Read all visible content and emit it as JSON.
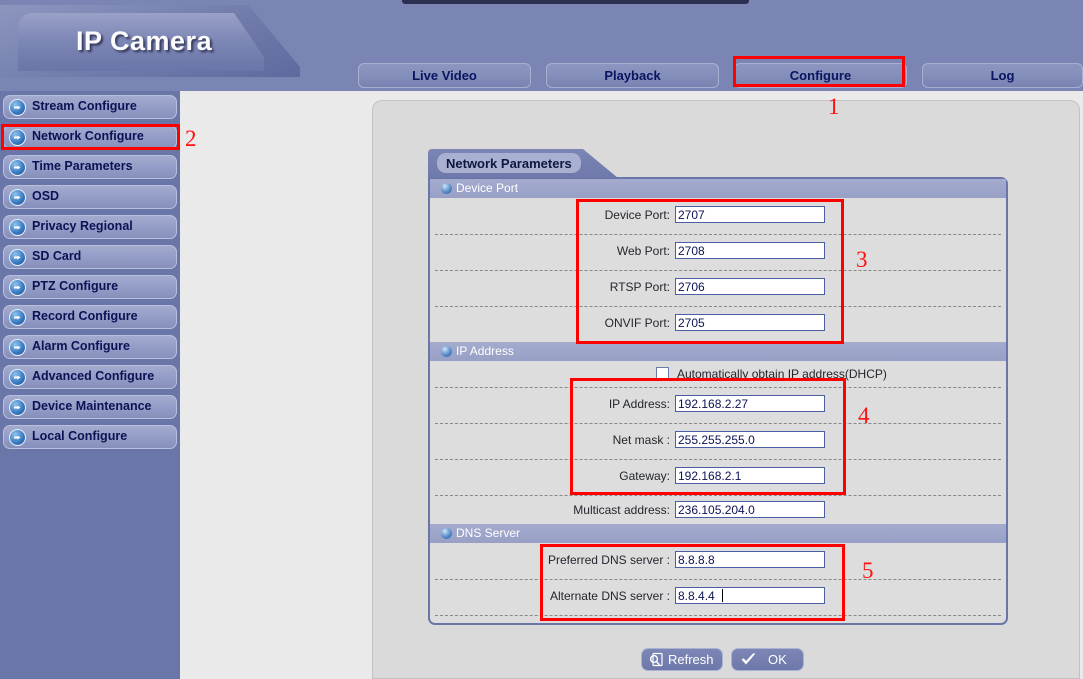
{
  "app": {
    "title": "IP Camera"
  },
  "nav": {
    "tabs": [
      {
        "id": "live",
        "label": "Live Video"
      },
      {
        "id": "playback",
        "label": "Playback"
      },
      {
        "id": "configure",
        "label": "Configure"
      },
      {
        "id": "log",
        "label": "Log"
      }
    ],
    "active": "Configure"
  },
  "sidebar": {
    "active": "Network Configure",
    "items": [
      {
        "label": "Stream Configure",
        "icon": "arrow-right-icon"
      },
      {
        "label": "Network Configure",
        "icon": "arrow-right-icon"
      },
      {
        "label": "Time Parameters",
        "icon": "arrow-right-icon"
      },
      {
        "label": "OSD",
        "icon": "arrow-right-icon"
      },
      {
        "label": "Privacy Regional",
        "icon": "arrow-right-icon"
      },
      {
        "label": "SD Card",
        "icon": "arrow-right-icon"
      },
      {
        "label": "PTZ Configure",
        "icon": "arrow-right-icon"
      },
      {
        "label": "Record Configure",
        "icon": "arrow-right-icon"
      },
      {
        "label": "Alarm Configure",
        "icon": "arrow-right-icon"
      },
      {
        "label": "Advanced Configure",
        "icon": "arrow-right-icon"
      },
      {
        "label": "Device Maintenance",
        "icon": "arrow-right-icon"
      },
      {
        "label": "Local Configure",
        "icon": "arrow-right-icon"
      }
    ]
  },
  "form": {
    "tab_title": "Network Parameters",
    "sections": {
      "device_port": {
        "title": "Device Port",
        "fields": [
          {
            "label": "Device Port:",
            "value": "2707"
          },
          {
            "label": "Web Port:",
            "value": "2708"
          },
          {
            "label": "RTSP Port:",
            "value": "2706"
          },
          {
            "label": "ONVIF Port:",
            "value": "2705"
          }
        ]
      },
      "ip_address": {
        "title": "IP Address",
        "dhcp_label": "Automatically obtain IP address(DHCP)",
        "dhcp_checked": false,
        "fields": [
          {
            "label": "IP Address:",
            "value": "192.168.2.27"
          },
          {
            "label": "Net mask :",
            "value": "255.255.255.0"
          },
          {
            "label": "Gateway:",
            "value": "192.168.2.1"
          },
          {
            "label": "Multicast address:",
            "value": "236.105.204.0"
          }
        ]
      },
      "dns_server": {
        "title": "DNS Server",
        "fields": [
          {
            "label": "Preferred DNS server :",
            "value": "8.8.8.8"
          },
          {
            "label": "Alternate DNS server :",
            "value": "8.8.4.4"
          }
        ]
      }
    }
  },
  "footer": {
    "refresh_label": "Refresh",
    "ok_label": "OK"
  },
  "annotations": [
    {
      "number": "1",
      "target": "configure-tab"
    },
    {
      "number": "2",
      "target": "network-configure-sidebar-item"
    },
    {
      "number": "3",
      "target": "device-port-fields"
    },
    {
      "number": "4",
      "target": "ip-address-fields"
    },
    {
      "number": "5",
      "target": "dns-server-fields"
    }
  ],
  "colors": {
    "annotation_red": "#ff0000",
    "header_blue": "#7b85b4",
    "panel_border": "#6b76a8",
    "section_header": "#a4abce"
  }
}
